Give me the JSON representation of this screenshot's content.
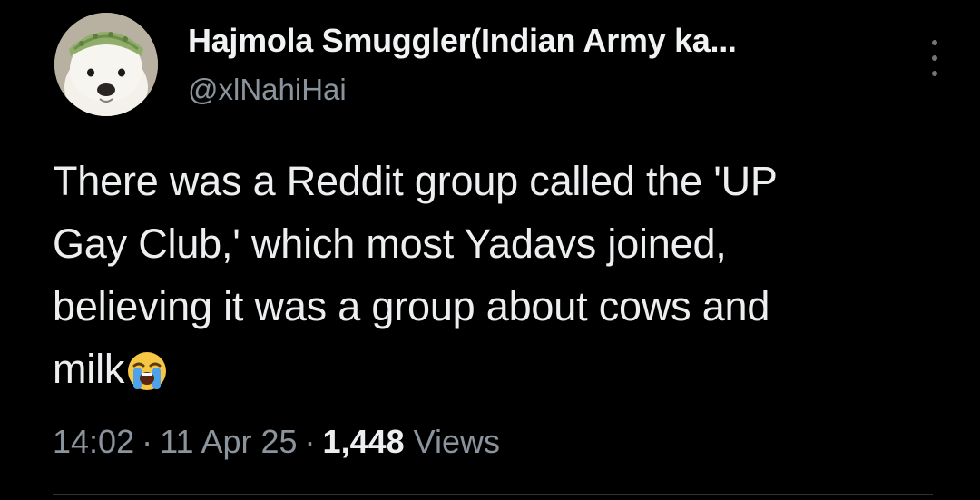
{
  "author": {
    "display_name": "Hajmola Smuggler(Indian Army ka...",
    "handle": "@xlNahiHai"
  },
  "tweet": {
    "text_lines": [
      "There was a Reddit group called the 'UP",
      "Gay Club,' which most Yadavs joined,",
      "believing it was a group about cows and",
      "milk"
    ],
    "emoji": "loudly-crying-face-icon"
  },
  "meta": {
    "time": "14:02",
    "separator": "·",
    "date": "11 Apr 25",
    "views_count": "1,448",
    "views_label": "Views"
  },
  "colors": {
    "background": "#000000",
    "primary_text": "#e7e9ea",
    "secondary_text": "#8b949c"
  }
}
